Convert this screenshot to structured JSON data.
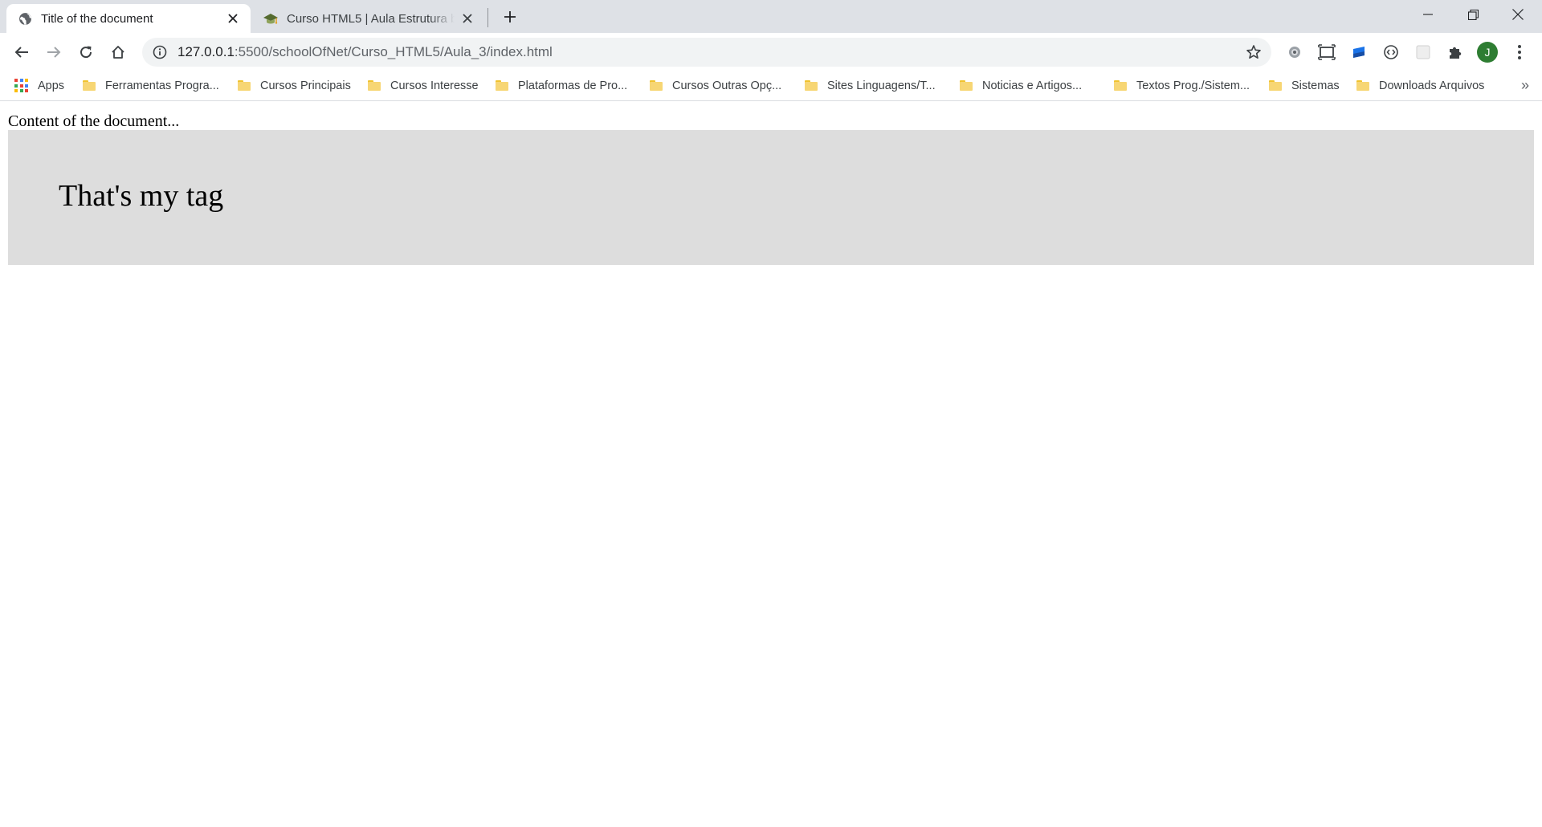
{
  "browser": {
    "tabs": [
      {
        "title": "Title of the document",
        "active": true,
        "favicon": "globe-icon"
      },
      {
        "title": "Curso HTML5 | Aula Estrutura básica",
        "active": false,
        "favicon": "school-of-net-icon"
      }
    ],
    "new_tab_icon": "plus-icon",
    "window_controls": [
      "minimize-icon",
      "restore-icon",
      "close-icon"
    ]
  },
  "toolbar": {
    "url_host": "127.0.0.1",
    "url_path": ":5500/schoolOfNet/Curso_HTML5/Aula_3/index.html",
    "profile_initial": "J",
    "profile_color": "#2e7d32"
  },
  "bookmarks": {
    "apps_label": "Apps",
    "items": [
      "Ferramentas Progra...",
      "Cursos Principais",
      "Cursos Interesse",
      "Plataformas de Pro...",
      "Cursos Outras Opç...",
      "Sites Linguagens/T...",
      "Noticias e Artigos...",
      "Textos Prog./Sistem...",
      "Sistemas",
      "Downloads Arquivos"
    ],
    "overflow": "»",
    "folder_color": "#f7d674"
  },
  "page": {
    "content_text": "Content of the document...",
    "my_tag_text": "That's my tag",
    "my_tag_background": "#dddddd"
  }
}
